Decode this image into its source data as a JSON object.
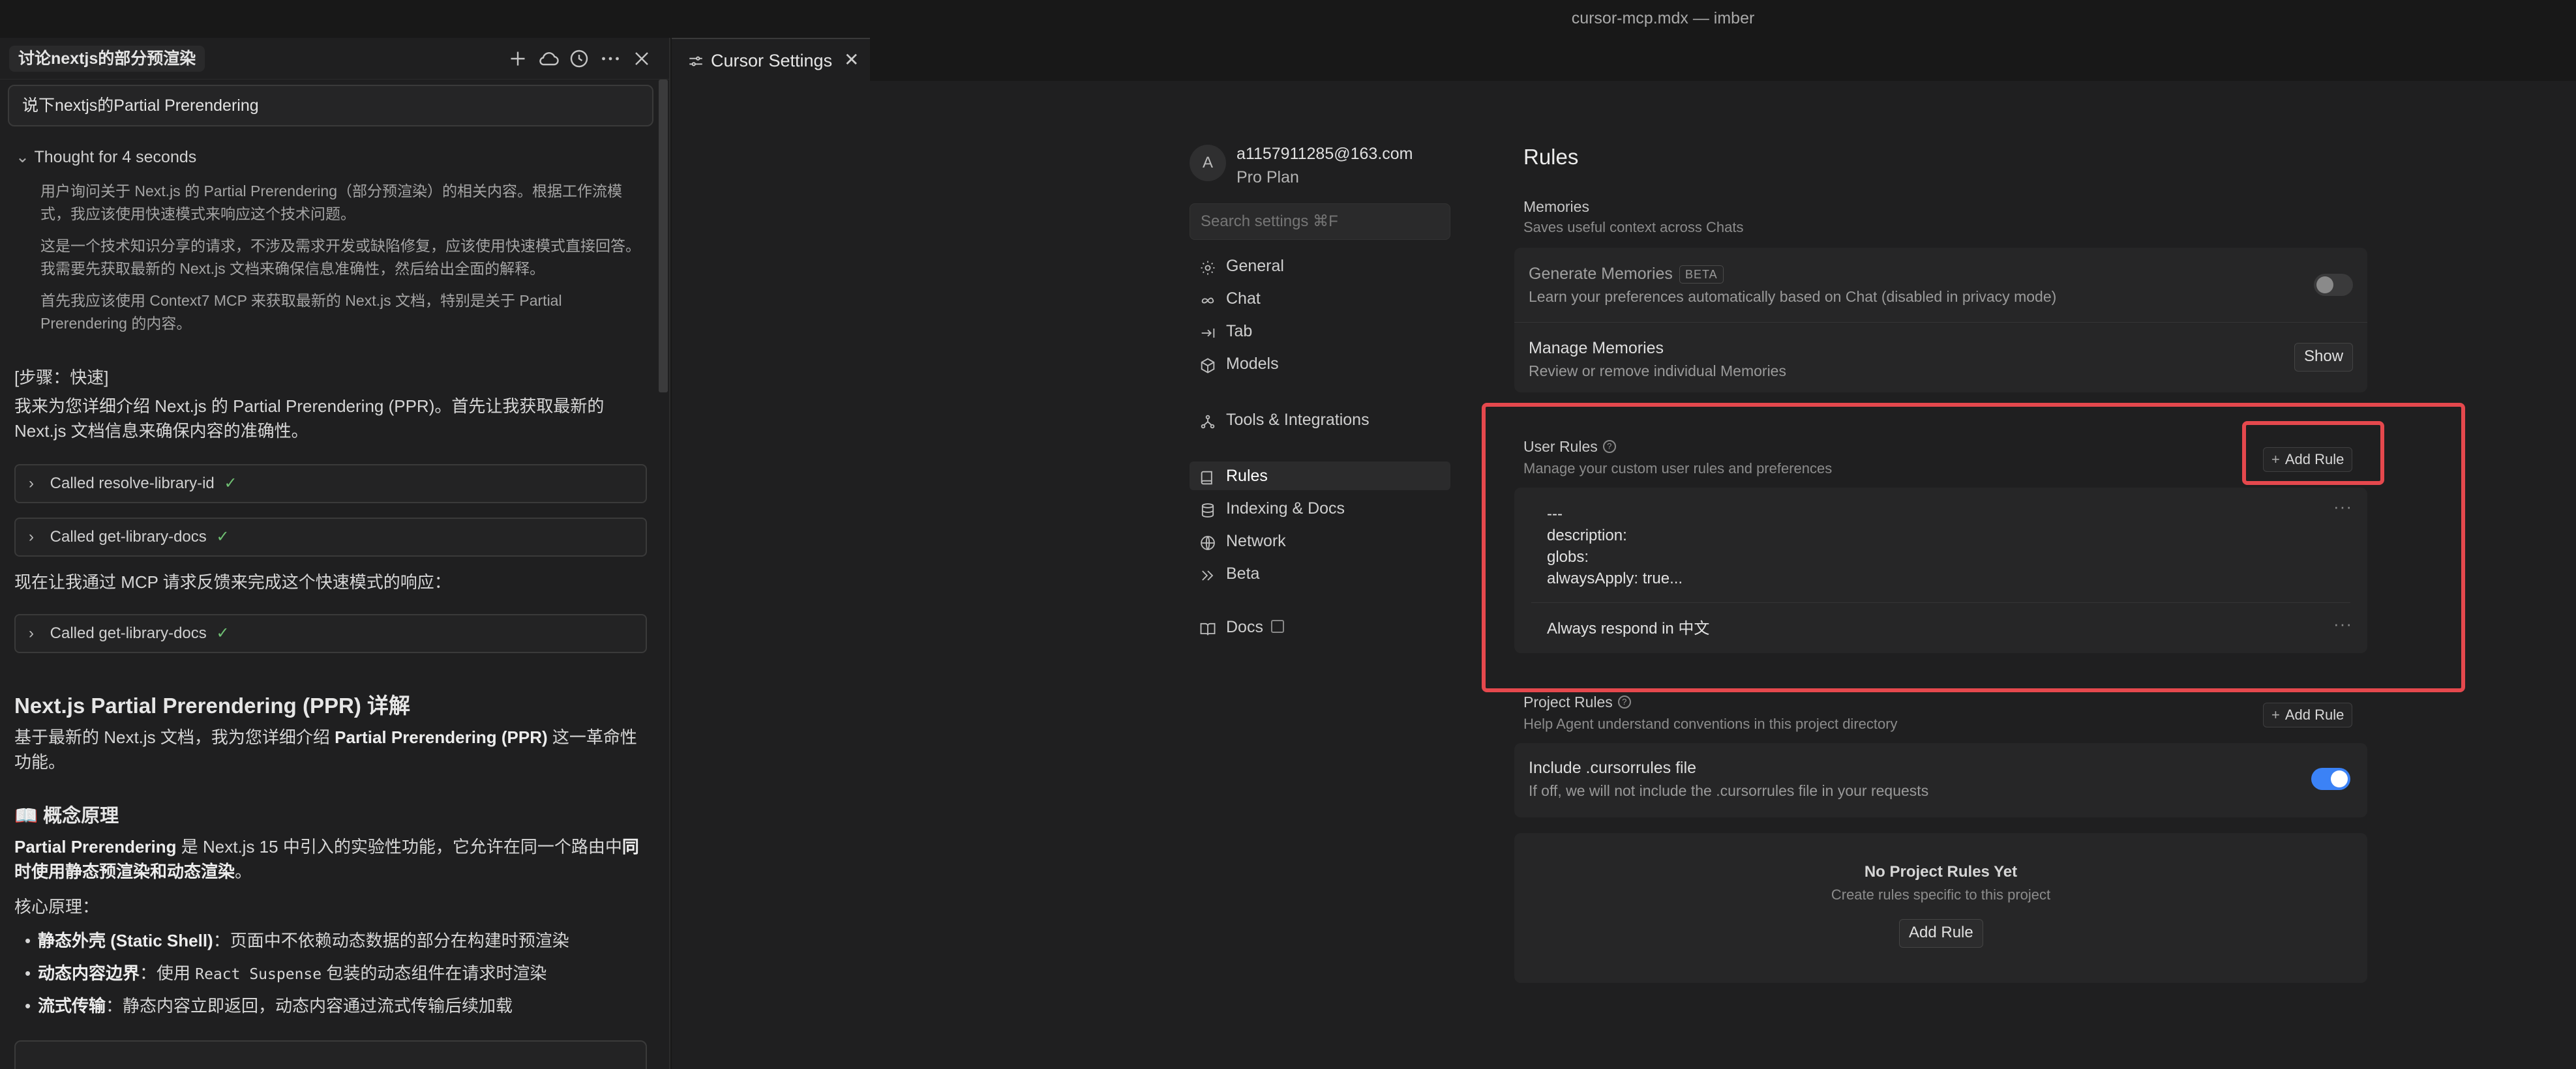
{
  "window": {
    "title": "cursor-mcp.mdx — imber"
  },
  "chat": {
    "title": "讨论nextjs的部分预渲染",
    "user_message": "说下nextjs的Partial Prerendering",
    "thought_label": "Thought for 4 seconds",
    "thought_paragraphs": [
      "用户询问关于 Next.js 的 Partial Prerendering（部分预渲染）的相关内容。根据工作流模式，我应该使用快速模式来响应这个技术问题。",
      "这是一个技术知识分享的请求，不涉及需求开发或缺陷修复，应该使用快速模式直接回答。我需要先获取最新的 Next.js 文档来确保信息准确性，然后给出全面的解释。",
      "首先我应该使用 Context7 MCP 来获取最新的 Next.js 文档，特别是关于 Partial Prerendering 的内容。"
    ],
    "step_label": "[步骤：快速]",
    "intro": "我来为您详细介绍 Next.js 的 Partial Prerendering (PPR)。首先让我获取最新的 Next.js 文档信息来确保内容的准确性。",
    "tool_calls": [
      "Called resolve-library-id",
      "Called get-library-docs",
      "Called get-library-docs"
    ],
    "mcp_line": "现在让我通过 MCP 请求反馈来完成这个快速模式的响应：",
    "heading": "Next.js Partial Prerendering (PPR) 详解",
    "para1_a": "基于最新的 Next.js 文档，我为您详细介绍 ",
    "para1_b": "Partial Prerendering (PPR)",
    "para1_c": " 这一革命性功能。",
    "subheading": "📖 概念原理",
    "para2_a": "Partial Prerendering",
    "para2_b": " 是 Next.js 15 中引入的实验性功能，它允许在同一个路由中",
    "para2_c": "同时使用静态预渲染和动态渲染",
    "para2_d": "。",
    "core_label": "核心原理：",
    "bullets": [
      {
        "bold": "静态外壳 (Static Shell)",
        "text": "：页面中不依赖动态数据的部分在构建时预渲染"
      },
      {
        "bold": "动态内容边界",
        "text_a": "：使用 ",
        "code": "React Suspense",
        "text_b": " 包装的动态组件在请求时渲染"
      },
      {
        "bold": "流式传输",
        "text": "：静态内容立即返回，动态内容通过流式传输后续加载"
      }
    ],
    "check_mark": "✓"
  },
  "tab": {
    "label": "Cursor Settings",
    "close_glyph": "✕"
  },
  "settings": {
    "account": {
      "avatar_letter": "A",
      "email": "a1157911285@163.com",
      "plan": "Pro Plan"
    },
    "search_placeholder": "Search settings ⌘F",
    "nav": [
      {
        "label": "General",
        "icon": "gear-icon"
      },
      {
        "label": "Chat",
        "icon": "infinity-icon"
      },
      {
        "label": "Tab",
        "icon": "tab-arrow-icon"
      },
      {
        "label": "Models",
        "icon": "cube-icon"
      },
      {
        "label": "Tools & Integrations",
        "icon": "nodes-icon"
      },
      {
        "label": "Rules",
        "icon": "book-icon",
        "active": true
      },
      {
        "label": "Indexing & Docs",
        "icon": "database-icon"
      },
      {
        "label": "Network",
        "icon": "globe-icon"
      },
      {
        "label": "Beta",
        "icon": "double-chevron-icon"
      },
      {
        "label": "Docs",
        "icon": "open-book-icon"
      }
    ],
    "page_title": "Rules",
    "memories": {
      "title": "Memories",
      "subtitle": "Saves useful context across Chats",
      "generate_title": "Generate Memories",
      "generate_badge": "BETA",
      "generate_sub": "Learn your preferences automatically based on Chat (disabled in privacy mode)",
      "generate_enabled": false,
      "manage_title": "Manage Memories",
      "manage_sub": "Review or remove individual Memories",
      "manage_button": "Show"
    },
    "user_rules": {
      "title": "User Rules",
      "subtitle": "Manage your custom user rules and preferences",
      "add_button": "Add Rule",
      "rules": [
        "---\ndescription:\nglobs:\nalwaysApply: true...",
        "Always respond in 中文"
      ],
      "more_glyph": "···"
    },
    "project_rules": {
      "title": "Project Rules",
      "subtitle": "Help Agent understand conventions in this project directory",
      "add_button": "Add Rule",
      "include_title": "Include .cursorrules file",
      "include_sub": "If off, we will not include the .cursorrules file in your requests",
      "include_enabled": true,
      "empty_title": "No Project Rules Yet",
      "empty_sub": "Create rules specific to this project",
      "empty_button": "Add Rule"
    }
  },
  "colors": {
    "accent": "#3b82f6",
    "highlight": "#e5484d",
    "toggle_off": "#3a3a3b"
  }
}
